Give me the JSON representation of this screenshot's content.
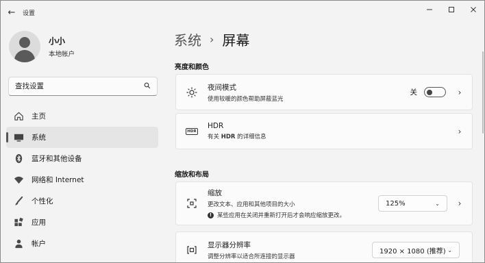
{
  "window": {
    "title": "设置",
    "minimize_icon": "minimize-icon",
    "maximize_icon": "maximize-icon",
    "close_icon": "close-icon"
  },
  "profile": {
    "name": "小小",
    "account_type": "本地帐户"
  },
  "search": {
    "placeholder": "查找设置"
  },
  "sidebar": {
    "items": [
      {
        "label": "主页",
        "icon": "home-icon"
      },
      {
        "label": "系统",
        "icon": "monitor-icon",
        "active": true
      },
      {
        "label": "蓝牙和其他设备",
        "icon": "bluetooth-icon"
      },
      {
        "label": "网络和 Internet",
        "icon": "wifi-icon"
      },
      {
        "label": "个性化",
        "icon": "brush-icon"
      },
      {
        "label": "应用",
        "icon": "apps-icon"
      },
      {
        "label": "帐户",
        "icon": "person-icon"
      }
    ]
  },
  "breadcrumb": {
    "parent": "系统",
    "separator": "›",
    "current": "屏幕"
  },
  "sections": {
    "brightness": "亮度和颜色",
    "scale_layout": "缩放和布局"
  },
  "night_light": {
    "title": "夜间模式",
    "desc": "使用较暖的颜色帮助屏蔽蓝光",
    "toggle_state": "关",
    "enabled": false
  },
  "hdr": {
    "title": "HDR",
    "desc_prefix": "有关",
    "desc_bold": "HDR",
    "desc_suffix": "的详细信息",
    "badge": "HDR"
  },
  "scale": {
    "title": "缩放",
    "desc": "更改文本、应用和其他项目的大小",
    "note": "某些应用在关闭并重新打开后才会响应缩放更改。",
    "value": "125%"
  },
  "resolution": {
    "title": "显示器分辨率",
    "desc": "调整分辨率以适合所连接的显示器",
    "value": "1920 × 1080 (推荐)"
  }
}
